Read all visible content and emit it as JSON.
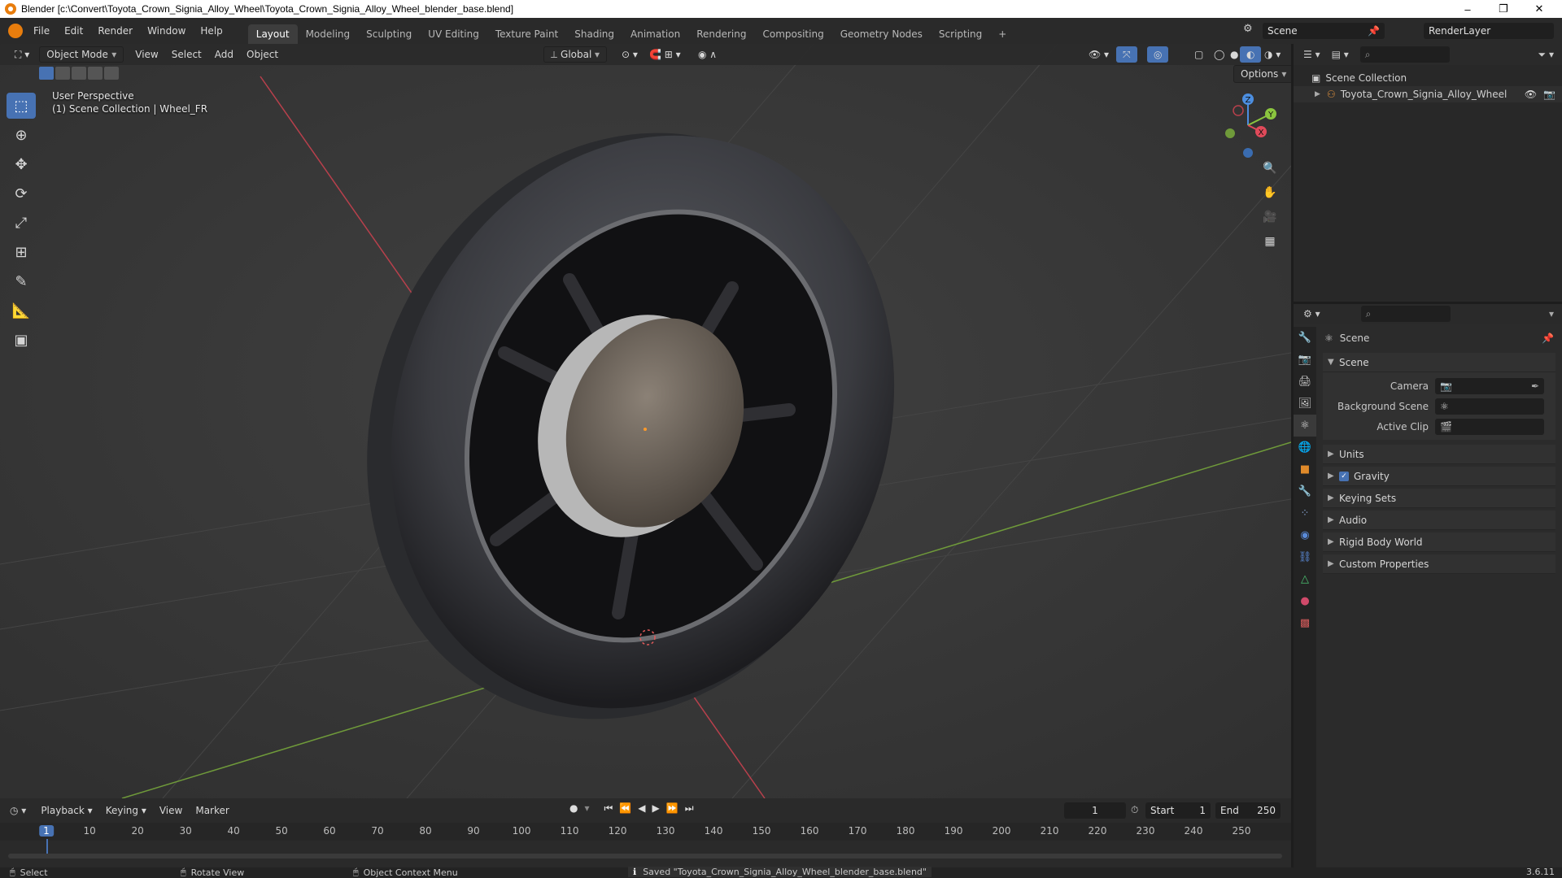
{
  "window": {
    "title": "Blender [c:\\Convert\\Toyota_Crown_Signia_Alloy_Wheel\\Toyota_Crown_Signia_Alloy_Wheel_blender_base.blend]",
    "min": "–",
    "max": "❐",
    "close": "✕"
  },
  "menu": [
    "File",
    "Edit",
    "Render",
    "Window",
    "Help"
  ],
  "workspaces": [
    "Layout",
    "Modeling",
    "Sculpting",
    "UV Editing",
    "Texture Paint",
    "Shading",
    "Animation",
    "Rendering",
    "Compositing",
    "Geometry Nodes",
    "Scripting"
  ],
  "add_workspace": "+",
  "scene_field": "Scene",
  "render_layer_field": "RenderLayer",
  "viewport": {
    "mode": "Object Mode",
    "menus": [
      "View",
      "Select",
      "Add",
      "Object"
    ],
    "transform_orientation": "Global",
    "options_label": "Options",
    "perspective": "User Perspective",
    "collection_info": "(1) Scene Collection | Wheel_FR",
    "gizmo": {
      "z": "Z",
      "y": "Y",
      "x": "X"
    }
  },
  "outliner": {
    "scene_collection": "Scene Collection",
    "object": "Toyota_Crown_Signia_Alloy_Wheel"
  },
  "properties": {
    "context": "Scene",
    "section_scene": "Scene",
    "camera_label": "Camera",
    "background_scene_label": "Background Scene",
    "active_clip_label": "Active Clip",
    "sections": [
      "Units",
      "Gravity",
      "Keying Sets",
      "Audio",
      "Rigid Body World",
      "Custom Properties"
    ],
    "gravity_checked": true
  },
  "timeline": {
    "menus": [
      "Playback",
      "Keying",
      "View",
      "Marker"
    ],
    "current_frame": "1",
    "start_label": "Start",
    "start_value": "1",
    "end_label": "End",
    "end_value": "250",
    "ticks": [
      "1",
      "10",
      "20",
      "30",
      "40",
      "50",
      "60",
      "70",
      "80",
      "90",
      "100",
      "110",
      "120",
      "130",
      "140",
      "150",
      "160",
      "170",
      "180",
      "190",
      "200",
      "210",
      "220",
      "230",
      "240",
      "250"
    ]
  },
  "status": {
    "select": "Select",
    "rotate": "Rotate View",
    "context_menu": "Object Context Menu",
    "message": "Saved \"Toyota_Crown_Signia_Alloy_Wheel_blender_base.blend\"",
    "version": "3.6.11"
  },
  "colors": {
    "accent": "#4772b3",
    "axis_x": "#e04a5a",
    "axis_y": "#8bc63f",
    "axis_z": "#4c8ee0",
    "playhead": "#4772b3"
  }
}
